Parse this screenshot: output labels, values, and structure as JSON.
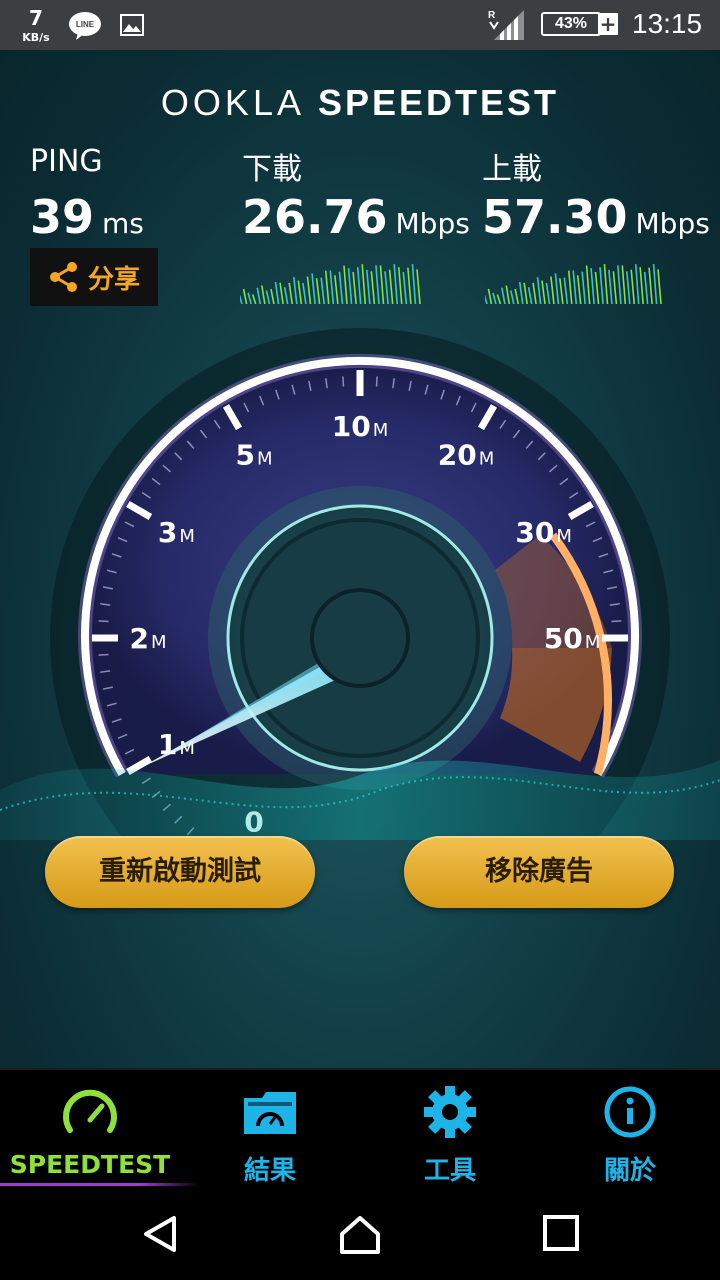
{
  "status_bar": {
    "net_speed": "7",
    "net_speed_unit": "KB/s",
    "line_icon_text": "LINE",
    "signal_tag": "R",
    "battery": "43%",
    "time": "13:15"
  },
  "header": {
    "brand_left": "OOKLA",
    "brand_right": "SPEEDTEST"
  },
  "results": {
    "ping": {
      "label": "PING",
      "value": "39",
      "unit": "ms"
    },
    "download": {
      "label": "下載",
      "value": "26.76",
      "unit": "Mbps"
    },
    "upload": {
      "label": "上載",
      "value": "57.30",
      "unit": "Mbps"
    },
    "share_label": "分享"
  },
  "gauge": {
    "ticks": [
      {
        "num": "0",
        "unit": ""
      },
      {
        "num": "1",
        "unit": "M"
      },
      {
        "num": "2",
        "unit": "M"
      },
      {
        "num": "3",
        "unit": "M"
      },
      {
        "num": "5",
        "unit": "M"
      },
      {
        "num": "10",
        "unit": "M"
      },
      {
        "num": "20",
        "unit": "M"
      },
      {
        "num": "30",
        "unit": "M"
      },
      {
        "num": "50",
        "unit": "M"
      }
    ],
    "needle_value": "0"
  },
  "buttons": {
    "restart": "重新啟動測試",
    "remove_ads": "移除廣告"
  },
  "tabs": [
    {
      "label": "SPEEDTEST",
      "icon": "speedometer-icon",
      "active": true
    },
    {
      "label": "結果",
      "icon": "results-folder-icon",
      "active": false
    },
    {
      "label": "工具",
      "icon": "gear-icon",
      "active": false
    },
    {
      "label": "關於",
      "icon": "info-icon",
      "active": false
    }
  ],
  "colors": {
    "accent_blue": "#1fb4e8",
    "accent_green": "#8ee03a",
    "button_gold": "#f2c14e",
    "share_orange": "#f5a623"
  }
}
